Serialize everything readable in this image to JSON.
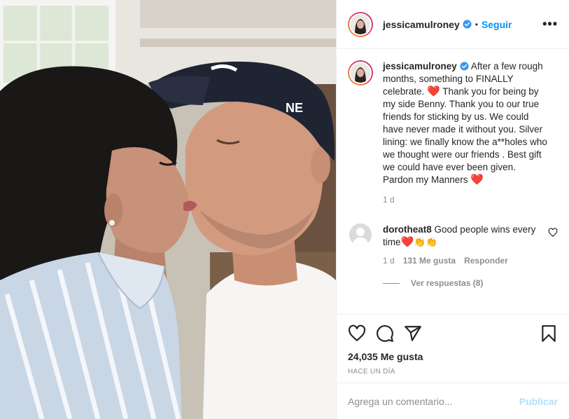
{
  "post": {
    "username": "jessicamulroney",
    "follow_label": "Seguir",
    "more_label": "•••",
    "caption": {
      "username": "jessicamulroney",
      "text_1": "After a few rough months, something to FINALLY celebrate.",
      "text_2": "Thank you for being by my side Benny. Thank you to our true friends for sticking by us. We could have never made it without you. Silver lining: we finally know the a**holes who we thought were our friends . Best gift we could have ever been given. Pardon my Manners",
      "time": "1 d"
    },
    "comments": [
      {
        "username": "dorotheat8",
        "text": "Good people wins every time",
        "time": "1 d",
        "likes": "131 Me gusta",
        "reply_label": "Responder",
        "view_replies": "Ver respuestas (8)"
      }
    ],
    "likes_count": "24,035 Me gusta",
    "posted_ago": "HACE UN DÍA",
    "add_comment_placeholder": "Agrega un comentario...",
    "publish_label": "Publicar"
  },
  "colors": {
    "link_blue": "#0095f6",
    "publish_disabled": "#b2dffc",
    "heart_red": "#e0245e",
    "muted_text": "#8e8e8e"
  },
  "icons": [
    "verified-badge-icon",
    "heart-icon",
    "comment-icon",
    "share-icon",
    "bookmark-icon",
    "more-options-icon"
  ]
}
